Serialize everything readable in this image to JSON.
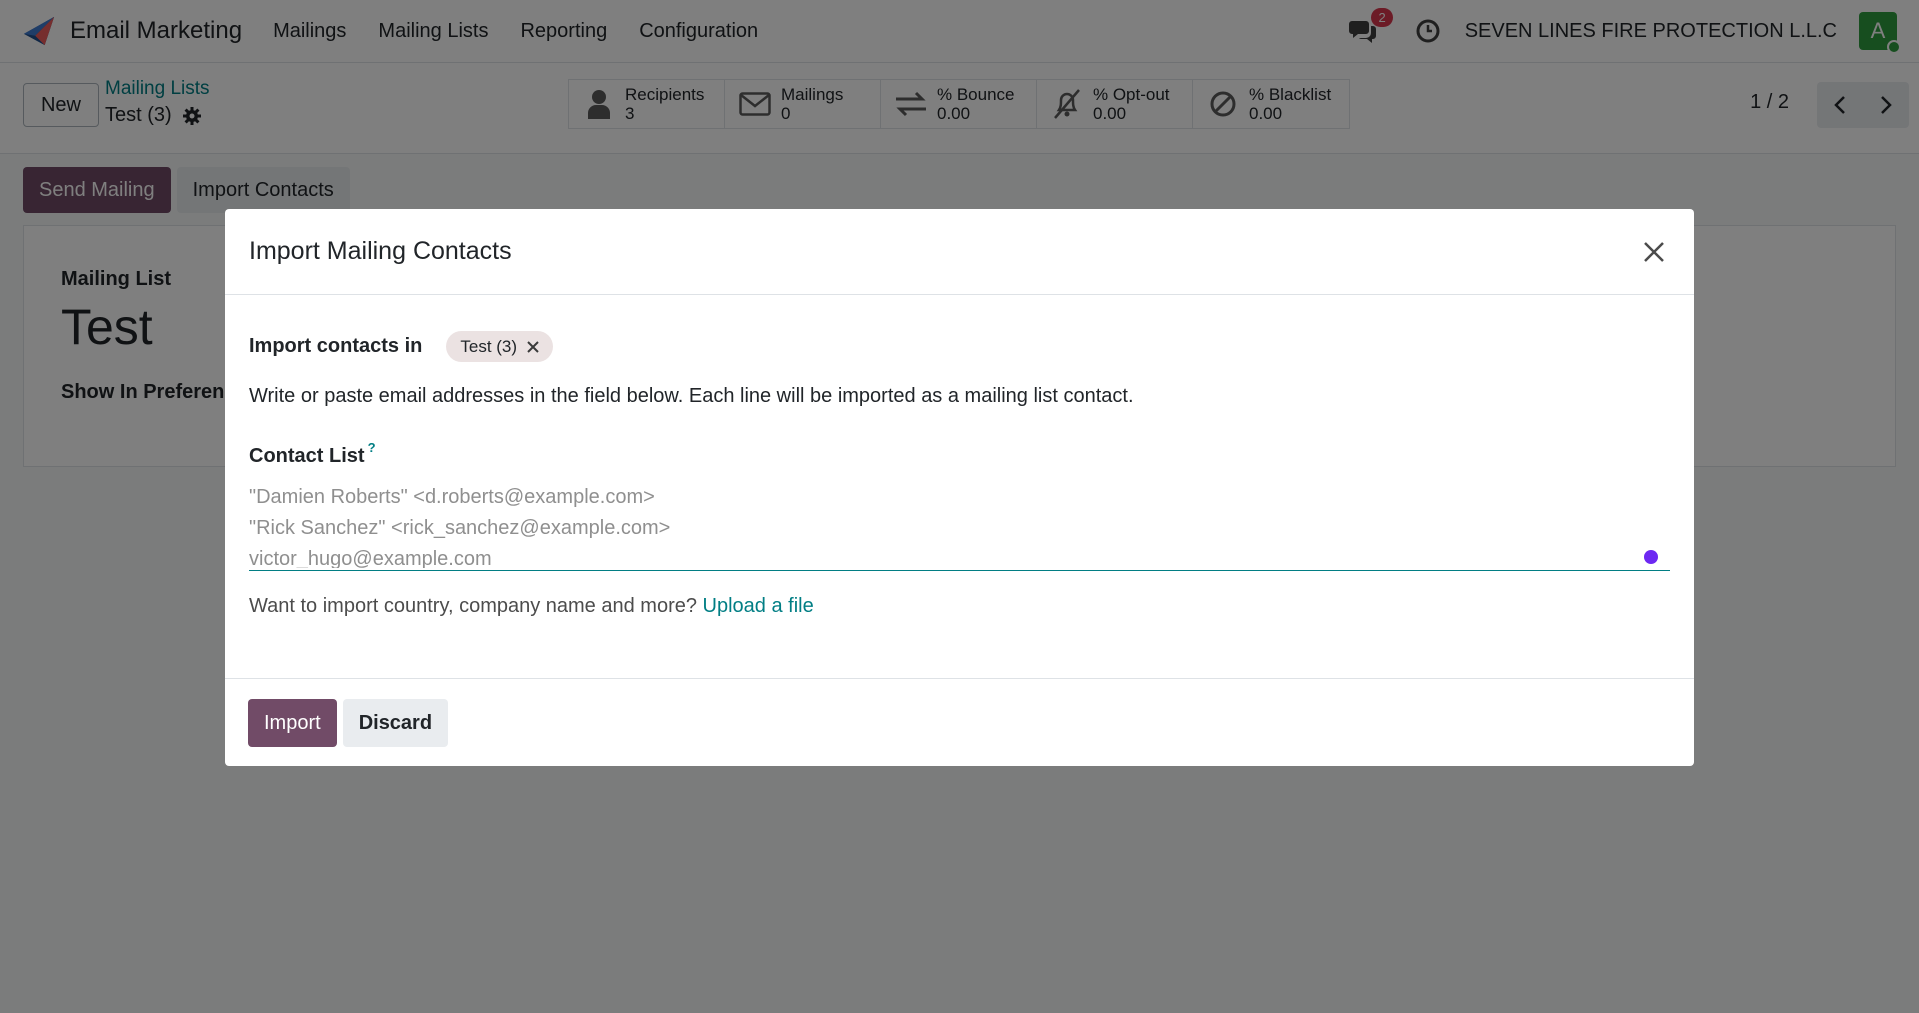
{
  "navbar": {
    "app_name": "Email Marketing",
    "menu": [
      "Mailings",
      "Mailing Lists",
      "Reporting",
      "Configuration"
    ],
    "chat_badge": "2",
    "company": "SEVEN LINES FIRE PROTECTION L.L.C",
    "avatar_letter": "A"
  },
  "control_panel": {
    "new_label": "New",
    "breadcrumb_parent": "Mailing Lists",
    "breadcrumb_current": "Test (3)",
    "stats": [
      {
        "label": "Recipients",
        "value": "3",
        "icon": "user-icon"
      },
      {
        "label": "Mailings",
        "value": "0",
        "icon": "envelope-icon"
      },
      {
        "label": "% Bounce",
        "value": "0.00",
        "icon": "exchange-icon"
      },
      {
        "label": "% Opt-out",
        "value": "0.00",
        "icon": "bell-slash-icon"
      },
      {
        "label": "% Blacklist",
        "value": "0.00",
        "icon": "ban-icon"
      }
    ],
    "pager": "1 / 2"
  },
  "form": {
    "send_mailing_label": "Send Mailing",
    "import_contacts_label": "Import Contacts",
    "mailing_list_label": "Mailing List",
    "title": "Test",
    "show_in_preferences_label": "Show In Preferen"
  },
  "modal": {
    "title": "Import Mailing Contacts",
    "import_in_label": "Import contacts in",
    "tag": "Test (3)",
    "help_text": "Write or paste email addresses in the field below. Each line will be imported as a mailing list contact.",
    "contact_list_label": "Contact List",
    "tooltip_mark": "?",
    "placeholder": "\"Damien Roberts\" <d.roberts@example.com>\n\"Rick Sanchez\" <rick_sanchez@example.com>\nvictor_hugo@example.com",
    "upload_prefix": "Want to import country, company name and more?",
    "upload_link": "Upload a file",
    "import_button": "Import",
    "discard_button": "Discard"
  },
  "colors": {
    "primary": "#714b67",
    "link": "#017e84",
    "badge": "#d9364c",
    "avatar": "#2f9d3e",
    "tag_bg": "#ebe2e2"
  }
}
